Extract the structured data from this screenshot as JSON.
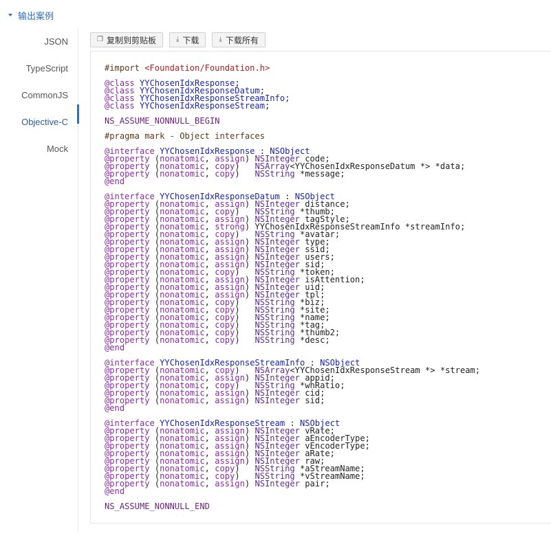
{
  "section": {
    "title": "输出案例"
  },
  "tabs": [
    {
      "label": "JSON",
      "active": false
    },
    {
      "label": "TypeScript",
      "active": false
    },
    {
      "label": "CommonJS",
      "active": false
    },
    {
      "label": "Objective-C",
      "active": true
    },
    {
      "label": "Mock",
      "active": false
    }
  ],
  "toolbar": {
    "copy_label": "复制到剪贴板",
    "download_label": "下载",
    "download_all_label": "下载所有"
  },
  "colors": {
    "accent": "#2f6fb7",
    "keyword": "#8a2aa3",
    "class_name": "#1a23b5",
    "string": "#b31c1c"
  },
  "code": {
    "import": "#import <Foundation/Foundation.h>",
    "class_decls": [
      "@class YYChosenIdxResponse;",
      "@class YYChosenIdxResponseDatum;",
      "@class YYChosenIdxResponseStreamInfo;",
      "@class YYChosenIdxResponseStream;"
    ],
    "begin": "NS_ASSUME_NONNULL_BEGIN",
    "pragma": "#pragma mark - Object interfaces",
    "interfaces": [
      {
        "name": "YYChosenIdxResponse",
        "superclass": "NSObject",
        "properties": [
          {
            "attrs": "(nonatomic, assign)",
            "type": "NSInteger",
            "decl": "code;"
          },
          {
            "attrs": "(nonatomic, copy)  ",
            "type": "NSArray",
            "decl": "<YYChosenIdxResponseDatum *> *data;"
          },
          {
            "attrs": "(nonatomic, copy)  ",
            "type": "NSString",
            "decl": "*message;"
          }
        ]
      },
      {
        "name": "YYChosenIdxResponseDatum",
        "superclass": "NSObject",
        "properties": [
          {
            "attrs": "(nonatomic, assign)",
            "type": "NSInteger",
            "decl": "distance;"
          },
          {
            "attrs": "(nonatomic, copy)  ",
            "type": "NSString",
            "decl": "*thumb;"
          },
          {
            "attrs": "(nonatomic, assign)",
            "type": "NSInteger",
            "decl": "tagStyle;"
          },
          {
            "attrs": "(nonatomic, strong)",
            "type": "",
            "decl": "YYChosenIdxResponseStreamInfo *streamInfo;"
          },
          {
            "attrs": "(nonatomic, copy)  ",
            "type": "NSString",
            "decl": "*avatar;"
          },
          {
            "attrs": "(nonatomic, assign)",
            "type": "NSInteger",
            "decl": "type;"
          },
          {
            "attrs": "(nonatomic, assign)",
            "type": "NSInteger",
            "decl": "ssid;"
          },
          {
            "attrs": "(nonatomic, assign)",
            "type": "NSInteger",
            "decl": "users;"
          },
          {
            "attrs": "(nonatomic, assign)",
            "type": "NSInteger",
            "decl": "sid;"
          },
          {
            "attrs": "(nonatomic, copy)  ",
            "type": "NSString",
            "decl": "*token;"
          },
          {
            "attrs": "(nonatomic, assign)",
            "type": "NSInteger",
            "decl": "isAttention;"
          },
          {
            "attrs": "(nonatomic, assign)",
            "type": "NSInteger",
            "decl": "uid;"
          },
          {
            "attrs": "(nonatomic, assign)",
            "type": "NSInteger",
            "decl": "tpl;"
          },
          {
            "attrs": "(nonatomic, copy)  ",
            "type": "NSString",
            "decl": "*biz;"
          },
          {
            "attrs": "(nonatomic, copy)  ",
            "type": "NSString",
            "decl": "*site;"
          },
          {
            "attrs": "(nonatomic, copy)  ",
            "type": "NSString",
            "decl": "*name;"
          },
          {
            "attrs": "(nonatomic, copy)  ",
            "type": "NSString",
            "decl": "*tag;"
          },
          {
            "attrs": "(nonatomic, copy)  ",
            "type": "NSString",
            "decl": "*thumb2;"
          },
          {
            "attrs": "(nonatomic, copy)  ",
            "type": "NSString",
            "decl": "*desc;"
          }
        ]
      },
      {
        "name": "YYChosenIdxResponseStreamInfo",
        "superclass": "NSObject",
        "properties": [
          {
            "attrs": "(nonatomic, copy)  ",
            "type": "NSArray",
            "decl": "<YYChosenIdxResponseStream *> *stream;"
          },
          {
            "attrs": "(nonatomic, assign)",
            "type": "NSInteger",
            "decl": "appid;"
          },
          {
            "attrs": "(nonatomic, copy)  ",
            "type": "NSString",
            "decl": "*whRatio;"
          },
          {
            "attrs": "(nonatomic, assign)",
            "type": "NSInteger",
            "decl": "cid;"
          },
          {
            "attrs": "(nonatomic, assign)",
            "type": "NSInteger",
            "decl": "sid;"
          }
        ]
      },
      {
        "name": "YYChosenIdxResponseStream",
        "superclass": "NSObject",
        "properties": [
          {
            "attrs": "(nonatomic, assign)",
            "type": "NSInteger",
            "decl": "vRate;"
          },
          {
            "attrs": "(nonatomic, assign)",
            "type": "NSInteger",
            "decl": "aEncoderType;"
          },
          {
            "attrs": "(nonatomic, assign)",
            "type": "NSInteger",
            "decl": "vEncoderType;"
          },
          {
            "attrs": "(nonatomic, assign)",
            "type": "NSInteger",
            "decl": "aRate;"
          },
          {
            "attrs": "(nonatomic, assign)",
            "type": "NSInteger",
            "decl": "raw;"
          },
          {
            "attrs": "(nonatomic, copy)  ",
            "type": "NSString",
            "decl": "*aStreamName;"
          },
          {
            "attrs": "(nonatomic, copy)  ",
            "type": "NSString",
            "decl": "*vStreamName;"
          },
          {
            "attrs": "(nonatomic, assign)",
            "type": "NSInteger",
            "decl": "pair;"
          }
        ]
      }
    ],
    "end": "NS_ASSUME_NONNULL_END"
  }
}
